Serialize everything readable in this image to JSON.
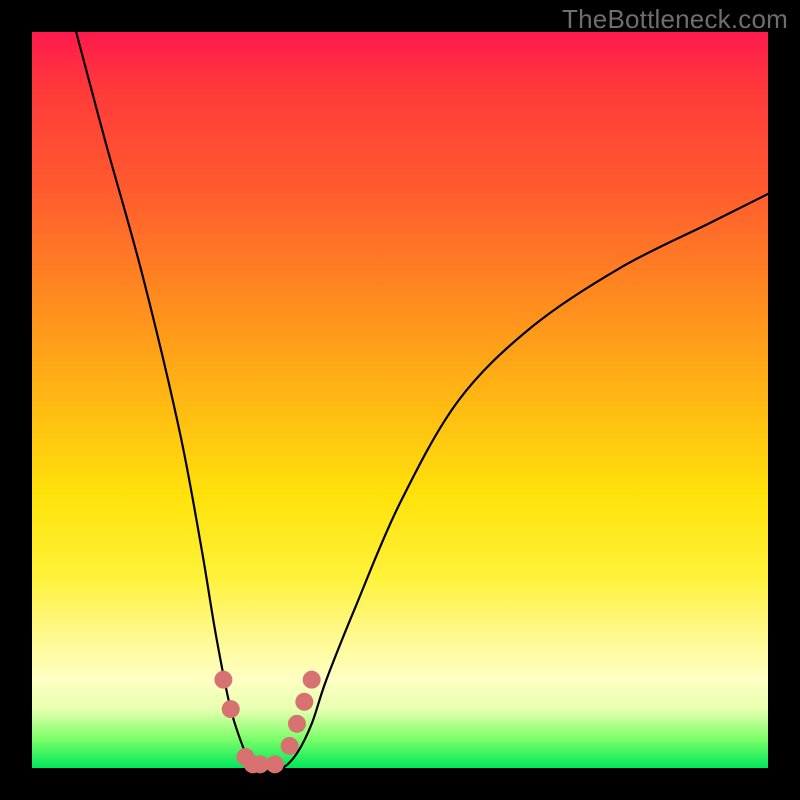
{
  "watermark": "TheBottleneck.com",
  "chart_data": {
    "type": "line",
    "title": "",
    "xlabel": "",
    "ylabel": "",
    "xlim": [
      0,
      100
    ],
    "ylim": [
      0,
      100
    ],
    "series": [
      {
        "name": "bottleneck-curve",
        "x": [
          6,
          10,
          15,
          20,
          23,
          25,
          27,
          29,
          30,
          31,
          32,
          34,
          36,
          38,
          40,
          44,
          50,
          58,
          68,
          80,
          92,
          100
        ],
        "y": [
          100,
          85,
          67,
          46,
          30,
          18,
          8,
          2,
          0,
          0,
          0,
          0,
          2,
          6,
          12,
          22,
          36,
          50,
          60,
          68,
          74,
          78
        ]
      }
    ],
    "markers": {
      "name": "highlight-dots",
      "color": "#d87270",
      "points": [
        {
          "x": 26,
          "y": 12
        },
        {
          "x": 27,
          "y": 8
        },
        {
          "x": 29,
          "y": 1.5
        },
        {
          "x": 30,
          "y": 0.5
        },
        {
          "x": 31,
          "y": 0.5
        },
        {
          "x": 33,
          "y": 0.5
        },
        {
          "x": 35,
          "y": 3
        },
        {
          "x": 36,
          "y": 6
        },
        {
          "x": 37,
          "y": 9
        },
        {
          "x": 38,
          "y": 12
        }
      ]
    },
    "background_gradient": {
      "top": "#ff1a4d",
      "mid": "#ffe20a",
      "bottom": "#00e65a"
    }
  }
}
